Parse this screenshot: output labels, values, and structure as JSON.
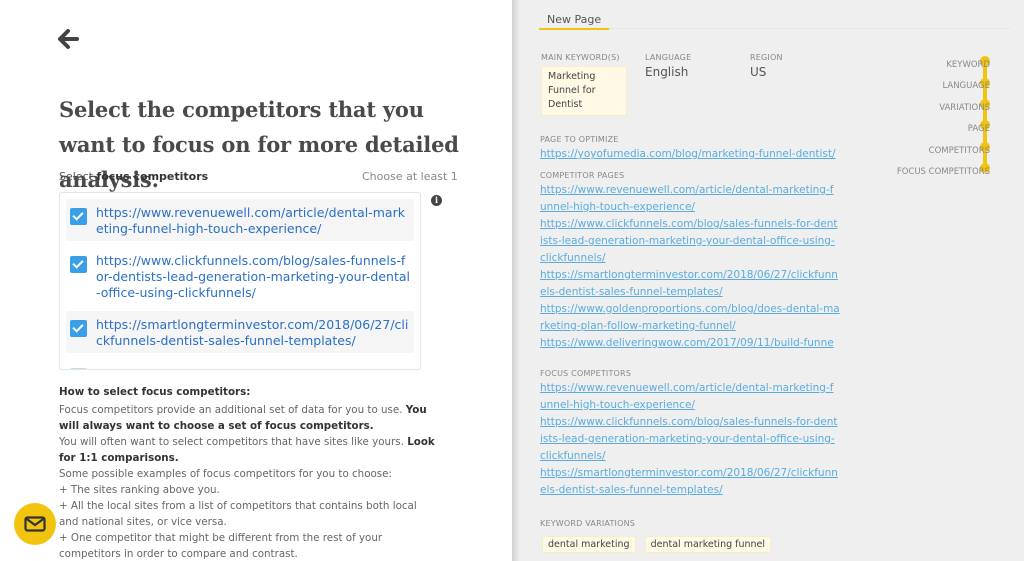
{
  "left": {
    "back_icon": "arrow-left-icon",
    "title": "Select the competitors that you want to focus on for more detailed analysis.",
    "select_label_prefix": "Select ",
    "select_label_bold": "focus competitors",
    "choose_hint": "Choose at least 1",
    "info_icon": "i",
    "competitors": [
      {
        "url": "https://www.revenuewell.com/article/dental-marketing-funnel-high-touch-experience/",
        "checked": true
      },
      {
        "url": "https://www.clickfunnels.com/blog/sales-funnels-for-dentists-lead-generation-marketing-your-dental-office-using-clickfunnels/",
        "checked": true
      },
      {
        "url": "https://smartlongterminvestor.com/2018/06/27/clickfunnels-dentist-sales-funnel-templates/",
        "checked": true
      }
    ],
    "howto": {
      "heading": "How to select focus competitors:",
      "p1": "Focus competitors provide an additional set of data for you to use. ",
      "p1_bold": "You will always want to choose a set of focus competitors.",
      "p2": "You will often want to select competitors that have sites like yours. ",
      "p2_bold": "Look for 1:1 comparisons.",
      "p3": "Some possible examples of focus competitors for you to choose:",
      "b1": "+ The sites ranking above you.",
      "b2": "+ All the local sites from a list of competitors that contains both local and national sites, or vice versa.",
      "b3": "+ One competitor that might be different from the rest of your competitors in order to compare and contrast."
    },
    "mail_icon": "envelope-icon"
  },
  "right": {
    "tab": "New Page",
    "main_keyword_label": "MAIN KEYWORD(S)",
    "main_keyword": "Marketing Funnel for Dentist",
    "language_label": "LANGUAGE",
    "language": "English",
    "region_label": "REGION",
    "region": "US",
    "page_label": "PAGE TO OPTIMIZE",
    "page_url": "https://yoyofumedia.com/blog/marketing-funnel-dentist/",
    "competitor_pages_label": "COMPETITOR PAGES",
    "competitor_pages": [
      "https://www.revenuewell.com/article/dental-marketing-funnel-high-touch-experience/",
      "https://www.clickfunnels.com/blog/sales-funnels-for-dentists-lead-generation-marketing-your-dental-office-using-clickfunnels/",
      "https://smartlongterminvestor.com/2018/06/27/clickfunnels-dentist-sales-funnel-templates/",
      "https://www.goldenproportions.com/blog/does-dental-marketing-plan-follow-marketing-funnel/",
      "https://www.deliveringwow.com/2017/09/11/build-funne"
    ],
    "focus_label": "FOCUS COMPETITORS",
    "focus_competitors": [
      "https://www.revenuewell.com/article/dental-marketing-funnel-high-touch-experience/",
      "https://www.clickfunnels.com/blog/sales-funnels-for-dentists-lead-generation-marketing-your-dental-office-using-clickfunnels/",
      "https://smartlongterminvestor.com/2018/06/27/clickfunnels-dentist-sales-funnel-templates/"
    ],
    "variations_label": "KEYWORD VARIATIONS",
    "variations": [
      "dental marketing",
      "dental marketing funnel"
    ],
    "steps": [
      "KEYWORD",
      "LANGUAGE",
      "VARIATIONS",
      "PAGE",
      "COMPETITORS",
      "FOCUS COMPETITORS"
    ],
    "accent_color": "#f2c40f",
    "link_color": "#5aacde"
  }
}
